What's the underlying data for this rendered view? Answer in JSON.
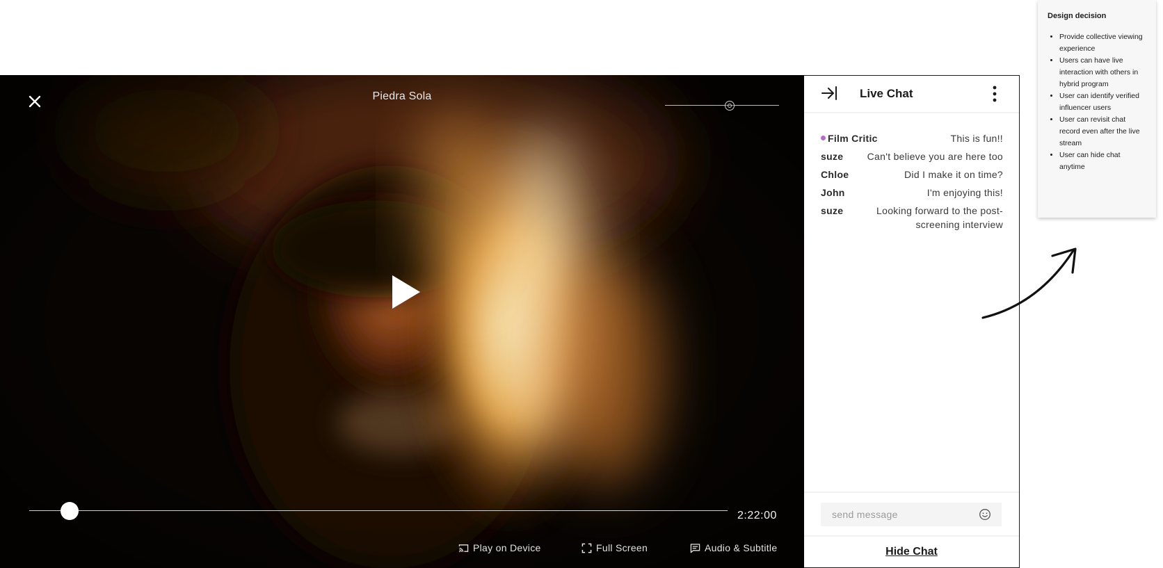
{
  "player": {
    "title": "Piedra Sola",
    "time": "2:22:00",
    "progress_fraction": 0.058,
    "volume_fraction": 0.57,
    "controls": {
      "play_on_device": "Play on Device",
      "full_screen": "Full Screen",
      "audio_subtitle": "Audio & Subtitle"
    },
    "icons": {
      "close": "close-icon",
      "play": "play-icon",
      "cast": "cast-icon",
      "fullscreen": "fullscreen-icon",
      "subtitle": "subtitle-icon"
    }
  },
  "chat": {
    "title": "Live Chat",
    "messages": [
      {
        "user": "Film Critic",
        "text": "This is fun!!",
        "verified": true
      },
      {
        "user": "suze",
        "text": "Can't believe you are here too",
        "verified": false
      },
      {
        "user": "Chloe",
        "text": "Did I make it on time?",
        "verified": false
      },
      {
        "user": "John",
        "text": "I'm enjoying this!",
        "verified": false
      },
      {
        "user": "suze",
        "text": "Looking forward to the post-screening interview",
        "verified": false
      }
    ],
    "input_placeholder": "send message",
    "input_value": "",
    "hide_label": "Hide Chat",
    "verified_color": "#b46cc9"
  },
  "annotation": {
    "title": "Design decision",
    "items": [
      "Provide collective viewing experience",
      "Users can have live interaction with others in hybrid program",
      "User can identify verified influencer users",
      "User can revisit chat record  even after the live stream",
      "User can hide chat anytime"
    ]
  }
}
